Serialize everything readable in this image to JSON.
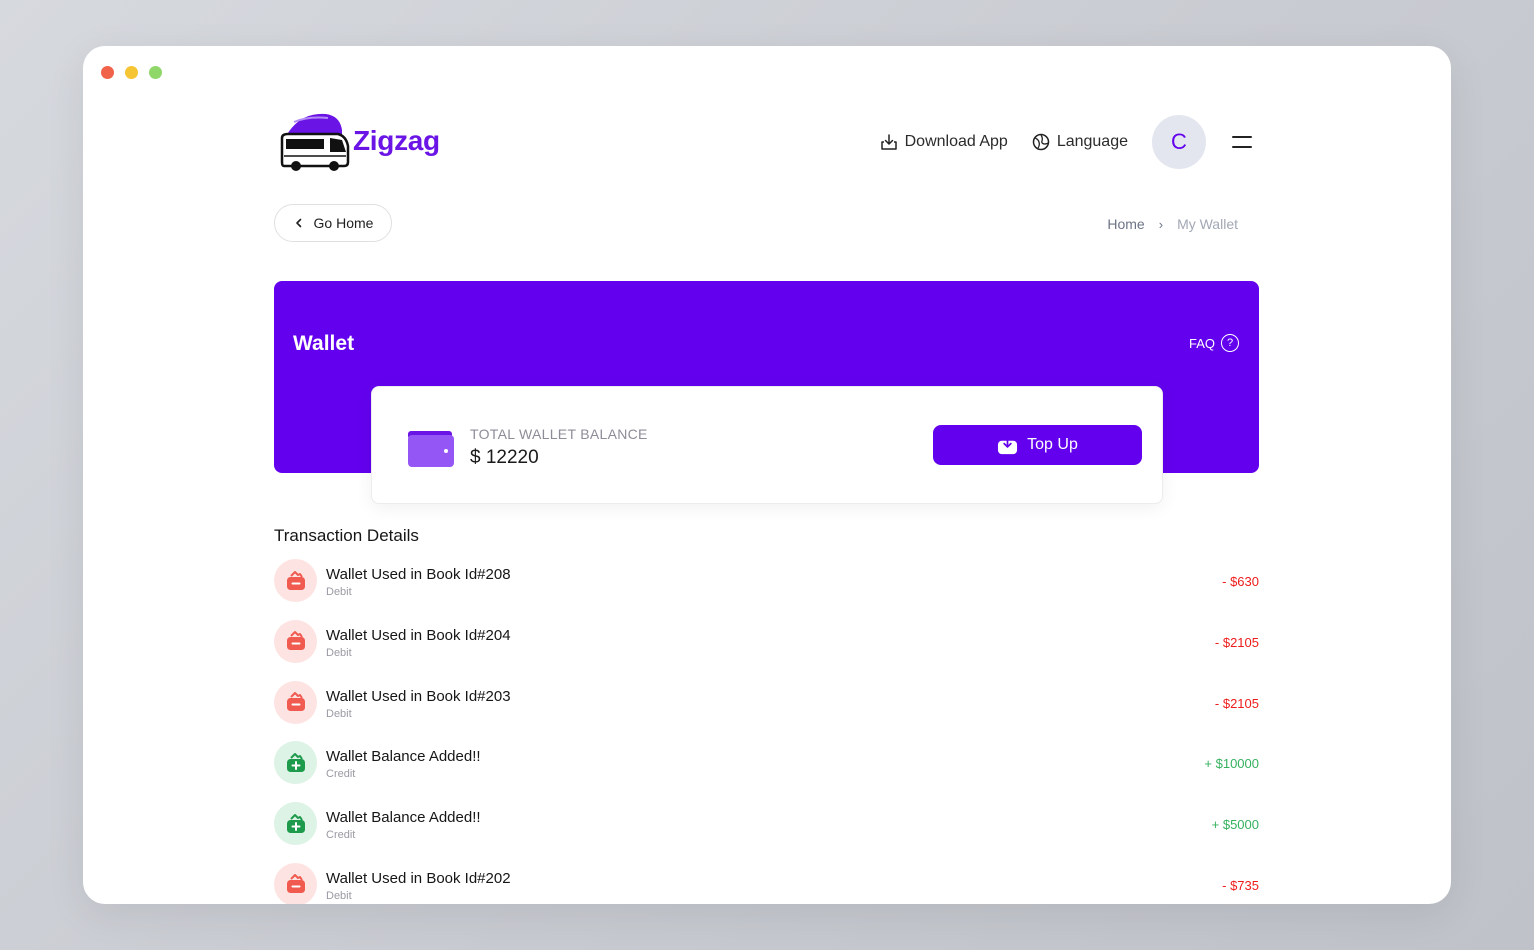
{
  "brand": {
    "name": "Zigzag",
    "color": "#6b14e6"
  },
  "header": {
    "download_app": "Download App",
    "language": "Language",
    "avatar_initial": "C"
  },
  "nav": {
    "go_home": "Go Home",
    "breadcrumb": {
      "home": "Home",
      "current": "My Wallet"
    }
  },
  "wallet": {
    "title": "Wallet",
    "faq": "FAQ",
    "balance_label": "TOTAL WALLET BALANCE",
    "balance_value": "$ 12220",
    "topup_label": "Top Up",
    "accent": "#6300ee"
  },
  "transactions": {
    "title": "Transaction Details",
    "items": [
      {
        "name": "Wallet Used in Book Id#208",
        "type": "Debit",
        "amount": "- $630",
        "kind": "debit"
      },
      {
        "name": "Wallet Used in Book Id#204",
        "type": "Debit",
        "amount": "- $2105",
        "kind": "debit"
      },
      {
        "name": "Wallet Used in Book Id#203",
        "type": "Debit",
        "amount": "- $2105",
        "kind": "debit"
      },
      {
        "name": "Wallet Balance Added!!",
        "type": "Credit",
        "amount": "+ $10000",
        "kind": "credit"
      },
      {
        "name": "Wallet Balance Added!!",
        "type": "Credit",
        "amount": "+ $5000",
        "kind": "credit"
      },
      {
        "name": "Wallet Used in Book Id#202",
        "type": "Debit",
        "amount": "- $735",
        "kind": "debit"
      }
    ],
    "colors": {
      "debit": "#ee1c1c",
      "credit": "#35b15e"
    }
  }
}
